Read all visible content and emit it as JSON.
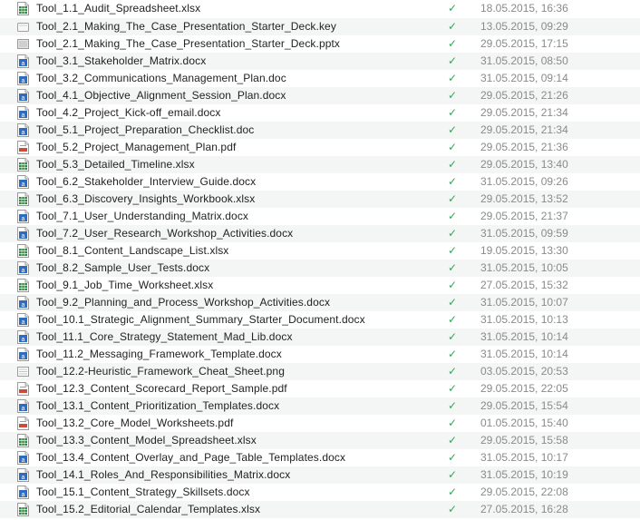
{
  "files": [
    {
      "name": "Tool_1.1_Audit_Spreadsheet.xlsx",
      "type": "xlsx",
      "icon": "spreadsheet-file-icon",
      "synced": true,
      "modified": "18.05.2015, 16:36"
    },
    {
      "name": "Tool_2.1_Making_The_Case_Presentation_Starter_Deck.key",
      "type": "key",
      "icon": "keynote-file-icon",
      "synced": true,
      "modified": "13.05.2015, 09:29"
    },
    {
      "name": "Tool_2.1_Making_The_Case_Presentation_Starter_Deck.pptx",
      "type": "pptx",
      "icon": "presentation-file-icon",
      "synced": true,
      "modified": "29.05.2015, 17:15"
    },
    {
      "name": "Tool_3.1_Stakeholder_Matrix.docx",
      "type": "docx",
      "icon": "word-document-icon",
      "synced": true,
      "modified": "31.05.2015, 08:50"
    },
    {
      "name": "Tool_3.2_Communications_Management_Plan.doc",
      "type": "doc",
      "icon": "word-document-icon",
      "synced": true,
      "modified": "31.05.2015, 09:14"
    },
    {
      "name": "Tool_4.1_Objective_Alignment_Session_Plan.docx",
      "type": "docx",
      "icon": "word-document-icon",
      "synced": true,
      "modified": "29.05.2015, 21:26"
    },
    {
      "name": "Tool_4.2_Project_Kick-off_email.docx",
      "type": "docx",
      "icon": "word-document-icon",
      "synced": true,
      "modified": "29.05.2015, 21:34"
    },
    {
      "name": "Tool_5.1_Project_Preparation_Checklist.doc",
      "type": "doc",
      "icon": "word-document-icon",
      "synced": true,
      "modified": "29.05.2015, 21:34"
    },
    {
      "name": "Tool_5.2_Project_Management_Plan.pdf",
      "type": "pdf",
      "icon": "pdf-file-icon",
      "synced": true,
      "modified": "29.05.2015, 21:36"
    },
    {
      "name": "Tool_5.3_Detailed_Timeline.xlsx",
      "type": "xlsx",
      "icon": "spreadsheet-file-icon",
      "synced": true,
      "modified": "29.05.2015, 13:40"
    },
    {
      "name": "Tool_6.2_Stakeholder_Interview_Guide.docx",
      "type": "docx",
      "icon": "word-document-icon",
      "synced": true,
      "modified": "31.05.2015, 09:26"
    },
    {
      "name": "Tool_6.3_Discovery_Insights_Workbook.xlsx",
      "type": "xlsx",
      "icon": "spreadsheet-file-icon",
      "synced": true,
      "modified": "29.05.2015, 13:52"
    },
    {
      "name": "Tool_7.1_User_Understanding_Matrix.docx",
      "type": "docx",
      "icon": "word-document-icon",
      "synced": true,
      "modified": "29.05.2015, 21:37"
    },
    {
      "name": "Tool_7.2_User_Research_Workshop_Activities.docx",
      "type": "docx",
      "icon": "word-document-icon",
      "synced": true,
      "modified": "31.05.2015, 09:59"
    },
    {
      "name": "Tool_8.1_Content_Landscape_List.xlsx",
      "type": "xlsx",
      "icon": "spreadsheet-file-icon",
      "synced": true,
      "modified": "19.05.2015, 13:30"
    },
    {
      "name": "Tool_8.2_Sample_User_Tests.docx",
      "type": "docx",
      "icon": "word-document-icon",
      "synced": true,
      "modified": "31.05.2015, 10:05"
    },
    {
      "name": "Tool_9.1_Job_Time_Worksheet.xlsx",
      "type": "xlsx",
      "icon": "spreadsheet-file-icon",
      "synced": true,
      "modified": "27.05.2015, 15:32"
    },
    {
      "name": "Tool_9.2_Planning_and_Process_Workshop_Activities.docx",
      "type": "docx",
      "icon": "word-document-icon",
      "synced": true,
      "modified": "31.05.2015, 10:07"
    },
    {
      "name": "Tool_10.1_Strategic_Alignment_Summary_Starter_Document.docx",
      "type": "docx",
      "icon": "word-document-icon",
      "synced": true,
      "modified": "31.05.2015, 10:13"
    },
    {
      "name": "Tool_11.1_Core_Strategy_Statement_Mad_Lib.docx",
      "type": "docx",
      "icon": "word-document-icon",
      "synced": true,
      "modified": "31.05.2015, 10:14"
    },
    {
      "name": "Tool_11.2_Messaging_Framework_Template.docx",
      "type": "docx",
      "icon": "word-document-icon",
      "synced": true,
      "modified": "31.05.2015, 10:14"
    },
    {
      "name": "Tool_12.2-Heuristic_Framework_Cheat_Sheet.png",
      "type": "png",
      "icon": "image-file-icon",
      "synced": true,
      "modified": "03.05.2015, 20:53"
    },
    {
      "name": "Tool_12.3_Content_Scorecard_Report_Sample.pdf",
      "type": "pdf",
      "icon": "pdf-file-icon",
      "synced": true,
      "modified": "29.05.2015, 22:05"
    },
    {
      "name": "Tool_13.1_Content_Prioritization_Templates.docx",
      "type": "docx",
      "icon": "word-document-icon",
      "synced": true,
      "modified": "29.05.2015, 15:54"
    },
    {
      "name": "Tool_13.2_Core_Model_Worksheets.pdf",
      "type": "pdf",
      "icon": "pdf-file-icon",
      "synced": true,
      "modified": "01.05.2015, 15:40"
    },
    {
      "name": "Tool_13.3_Content_Model_Spreadsheet.xlsx",
      "type": "xlsx",
      "icon": "spreadsheet-file-icon",
      "synced": true,
      "modified": "29.05.2015, 15:58"
    },
    {
      "name": "Tool_13.4_Content_Overlay_and_Page_Table_Templates.docx",
      "type": "docx",
      "icon": "word-document-icon",
      "synced": true,
      "modified": "31.05.2015, 10:17"
    },
    {
      "name": "Tool_14.1_Roles_And_Responsibilities_Matrix.docx",
      "type": "docx",
      "icon": "word-document-icon",
      "synced": true,
      "modified": "31.05.2015, 10:19"
    },
    {
      "name": "Tool_15.1_Content_Strategy_Skillsets.docx",
      "type": "docx",
      "icon": "word-document-icon",
      "synced": true,
      "modified": "29.05.2015, 22:08"
    },
    {
      "name": "Tool_15.2_Editorial_Calendar_Templates.xlsx",
      "type": "xlsx",
      "icon": "spreadsheet-file-icon",
      "synced": true,
      "modified": "27.05.2015, 16:28"
    }
  ],
  "sync_mark": "✓",
  "colors": {
    "row_alt": "#f4f5f5",
    "check": "#35a35a",
    "date": "#8a8a8a",
    "word": "#2b6cc4",
    "excel": "#2f8a3f",
    "pdf": "#d04a3a"
  }
}
